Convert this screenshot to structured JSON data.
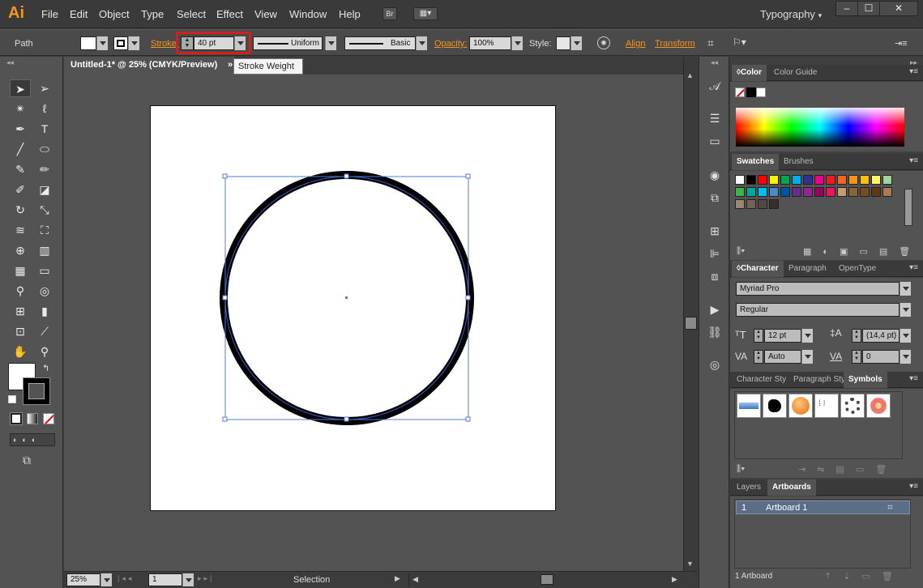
{
  "app": {
    "logo": "Ai",
    "menus": [
      "File",
      "Edit",
      "Object",
      "Type",
      "Select",
      "Effect",
      "View",
      "Window",
      "Help"
    ],
    "bridge_label": "Br",
    "workspace": "Typography",
    "window_controls": [
      "–",
      "☐",
      "✕"
    ]
  },
  "control_bar": {
    "selection_type": "Path",
    "stroke_label": "Stroke:",
    "stroke_weight": "40 pt",
    "profile_value": "Uniform",
    "brush_value": "Basic",
    "opacity_label": "Opacity:",
    "opacity_value": "100%",
    "style_label": "Style:",
    "align_label": "Align",
    "transform_label": "Transform"
  },
  "tooltip": "Stroke Weight",
  "document": {
    "tab_title": "Untitled-1* @ 25% (CMYK/Preview)",
    "tab_close": "»"
  },
  "status_bar": {
    "zoom": "25%",
    "artboard_number": "1",
    "tool_status": "Selection"
  },
  "color_panel": {
    "tabs": [
      "Color",
      "Color Guide"
    ]
  },
  "swatches_panel": {
    "tabs": [
      "Swatches",
      "Brushes"
    ],
    "colors": [
      "#ffffff",
      "#000000",
      "#ff0000",
      "#fff200",
      "#00a651",
      "#00aeef",
      "#2e3192",
      "#ec008c",
      "#ed1c24",
      "#f26522",
      "#f7941d",
      "#fbbf0f",
      "#fff568",
      "#a3d39c",
      "#39b54a",
      "#00a99d",
      "#00bff3",
      "#448ccb",
      "#0054a6",
      "#662d91",
      "#92278f",
      "#9e005d",
      "#ed145b",
      "#c69c6d",
      "#8c6239",
      "#754c24",
      "#603913",
      "#a67c52",
      "#998675",
      "#736357",
      "#534741",
      "#362f2d"
    ]
  },
  "character_panel": {
    "tabs": [
      "Character",
      "Paragraph",
      "OpenType"
    ],
    "font_family": "Myriad Pro",
    "font_style": "Regular",
    "font_size": "12 pt",
    "leading": "(14,4 pt)",
    "kerning": "Auto",
    "tracking": "0"
  },
  "symbols_panel": {
    "tabs": [
      "Character Sty",
      "Paragraph Sty",
      "Symbols"
    ]
  },
  "artboards_panel": {
    "tabs": [
      "Layers",
      "Artboards"
    ],
    "rows": [
      {
        "number": "1",
        "name": "Artboard 1"
      }
    ],
    "footer": "1 Artboard"
  }
}
